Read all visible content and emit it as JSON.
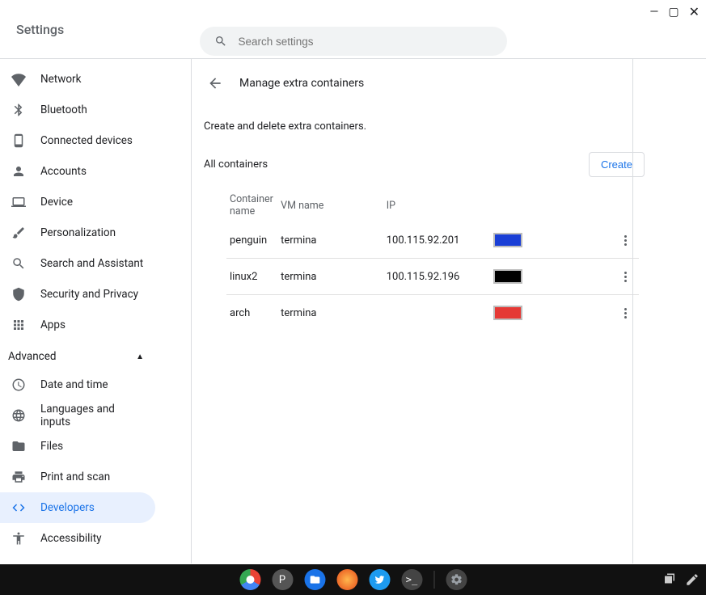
{
  "window": {
    "title": "Settings"
  },
  "search": {
    "placeholder": "Search settings"
  },
  "sidebar": {
    "items": [
      {
        "label": "Network"
      },
      {
        "label": "Bluetooth"
      },
      {
        "label": "Connected devices"
      },
      {
        "label": "Accounts"
      },
      {
        "label": "Device"
      },
      {
        "label": "Personalization"
      },
      {
        "label": "Search and Assistant"
      },
      {
        "label": "Security and Privacy"
      },
      {
        "label": "Apps"
      }
    ],
    "advanced_label": "Advanced",
    "advanced_items": [
      {
        "label": "Date and time"
      },
      {
        "label": "Languages and inputs"
      },
      {
        "label": "Files"
      },
      {
        "label": "Print and scan"
      },
      {
        "label": "Developers"
      },
      {
        "label": "Accessibility"
      }
    ]
  },
  "page": {
    "title": "Manage extra containers",
    "subtitle": "Create and delete extra containers.",
    "all_label": "All containers",
    "create_label": "Create",
    "columns": {
      "cname": "Container name",
      "vmname": "VM name",
      "ip": "IP"
    },
    "rows": [
      {
        "cname": "penguin",
        "vmname": "termina",
        "ip": "100.115.92.201",
        "color": "#1a3fd6"
      },
      {
        "cname": "linux2",
        "vmname": "termina",
        "ip": "100.115.92.196",
        "color": "#000000"
      },
      {
        "cname": "arch",
        "vmname": "termina",
        "ip": "",
        "color": "#e53935"
      }
    ]
  },
  "shelf": {
    "apps": [
      {
        "name": "chrome",
        "bg": "#ffffff"
      },
      {
        "name": "P",
        "bg": "#555555"
      },
      {
        "name": "files",
        "bg": "#1a73e8"
      },
      {
        "name": "fox",
        "bg": "#ff7043"
      },
      {
        "name": "twitter",
        "bg": "#1d9bf0"
      },
      {
        "name": "terminal",
        "bg": "#555555"
      },
      {
        "name": "settings",
        "bg": "#555555"
      }
    ]
  }
}
